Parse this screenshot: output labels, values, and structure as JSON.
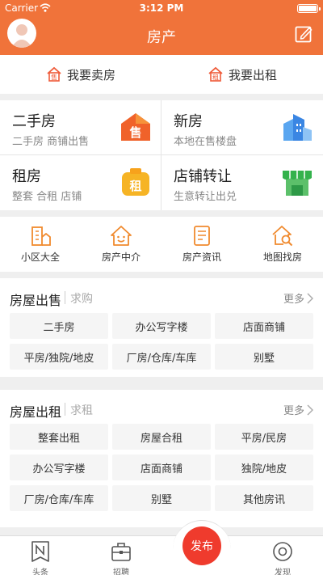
{
  "status": {
    "carrier": "Carrier",
    "time": "3:12 PM"
  },
  "header": {
    "title": "房产"
  },
  "quick": [
    {
      "label": "我要卖房",
      "icon": "sell-house-icon"
    },
    {
      "label": "我要出租",
      "icon": "rent-house-icon"
    }
  ],
  "grid": [
    {
      "title": "二手房",
      "sub": "二手房 商铺出售",
      "icon": "sell-badge-icon"
    },
    {
      "title": "新房",
      "sub": "本地在售楼盘",
      "icon": "buildings-icon"
    },
    {
      "title": "租房",
      "sub": "整套 合租 店铺",
      "icon": "rent-badge-icon"
    },
    {
      "title": "店铺转让",
      "sub": "生意转让出兑",
      "icon": "shop-icon"
    }
  ],
  "tools": [
    {
      "label": "小区大全",
      "icon": "community-icon"
    },
    {
      "label": "房产中介",
      "icon": "agent-icon"
    },
    {
      "label": "房产资讯",
      "icon": "news-icon"
    },
    {
      "label": "地图找房",
      "icon": "map-search-icon"
    }
  ],
  "sale": {
    "title": "房屋出售",
    "sub": "求购",
    "more": "更多",
    "tags": [
      "二手房",
      "办公写字楼",
      "店面商铺",
      "平房/独院/地皮",
      "厂房/仓库/车库",
      "别墅"
    ]
  },
  "rent": {
    "title": "房屋出租",
    "sub": "求租",
    "more": "更多",
    "tags": [
      "整套出租",
      "房屋合租",
      "平房/民房",
      "办公写字楼",
      "店面商铺",
      "独院/地皮",
      "厂房/仓库/车库",
      "别墅",
      "其他房讯"
    ]
  },
  "tabbar": {
    "headlines": "头条",
    "jobs": "招聘",
    "publish": "发布",
    "discover": "发现"
  }
}
